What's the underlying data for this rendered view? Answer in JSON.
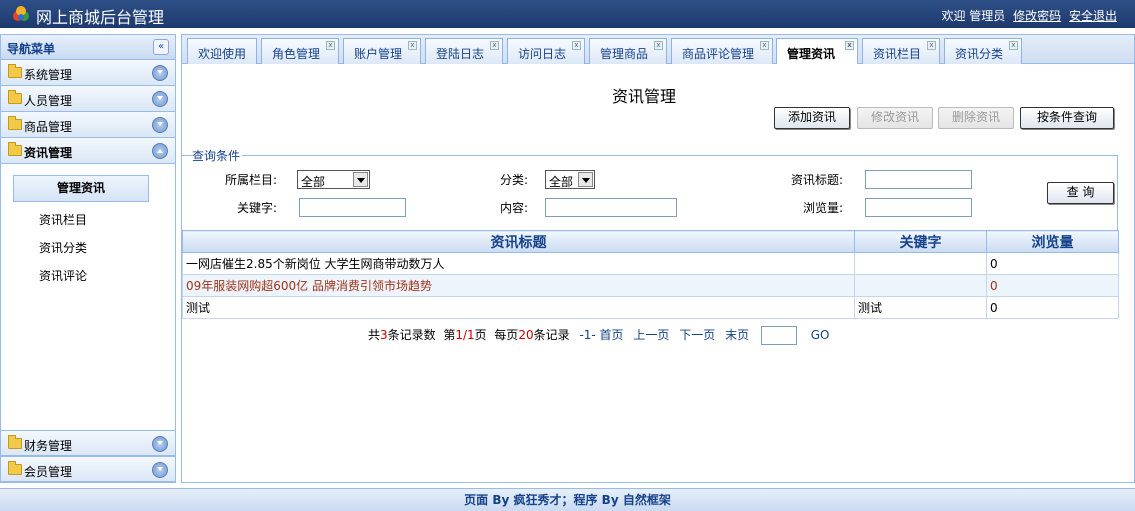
{
  "header": {
    "title": "网上商城后台管理",
    "welcome": "欢迎 管理员",
    "change_password": "修改密码",
    "logout": "安全退出"
  },
  "sidebar": {
    "title": "导航菜单",
    "menus": [
      {
        "label": "系统管理"
      },
      {
        "label": "人员管理"
      },
      {
        "label": "商品管理"
      },
      {
        "label": "资讯管理"
      }
    ],
    "submenu": [
      "管理资讯",
      "资讯栏目",
      "资讯分类",
      "资讯评论"
    ],
    "bottom_menus": [
      {
        "label": "财务管理"
      },
      {
        "label": "会员管理"
      }
    ]
  },
  "tabs": [
    {
      "label": "欢迎使用"
    },
    {
      "label": "角色管理"
    },
    {
      "label": "账户管理"
    },
    {
      "label": "登陆日志"
    },
    {
      "label": "访问日志"
    },
    {
      "label": "管理商品"
    },
    {
      "label": "商品评论管理"
    },
    {
      "label": "管理资讯"
    },
    {
      "label": "资讯栏目"
    },
    {
      "label": "资讯分类"
    }
  ],
  "main": {
    "title": "资讯管理",
    "buttons": {
      "add": "添加资讯",
      "edit": "修改资讯",
      "delete": "删除资讯",
      "search_by": "按条件查询"
    },
    "query": {
      "legend": "查询条件",
      "column_label": "所属栏目:",
      "column_value": "全部",
      "category_label": "分类:",
      "category_value": "全部",
      "title_label": "资讯标题:",
      "keyword_label": "关键字:",
      "content_label": "内容:",
      "views_label": "浏览量:",
      "search_button": "查 询"
    },
    "table": {
      "headers": [
        "资讯标题",
        "关键字",
        "浏览量"
      ],
      "rows": [
        {
          "title": "一网店催生2.85个新岗位 大学生网商带动数万人",
          "keyword": "",
          "views": "0"
        },
        {
          "title": "09年服装网购超600亿 品牌消费引领市场趋势",
          "keyword": "",
          "views": "0"
        },
        {
          "title": "测试",
          "keyword": "测试",
          "views": "0"
        }
      ]
    },
    "pager": {
      "total_prefix": "共",
      "total": "3",
      "total_suffix": "条记录数",
      "page_prefix": "第",
      "page": "1/1",
      "page_suffix": "页",
      "per_prefix": "每页",
      "per": "20",
      "per_suffix": "条记录",
      "first": "-1- 首页",
      "prev": "上一页",
      "next": "下一页",
      "last": "末页",
      "go": "GO"
    }
  },
  "footer": {
    "text": "页面 By 疯狂秀才；程序 By 自然框架"
  }
}
